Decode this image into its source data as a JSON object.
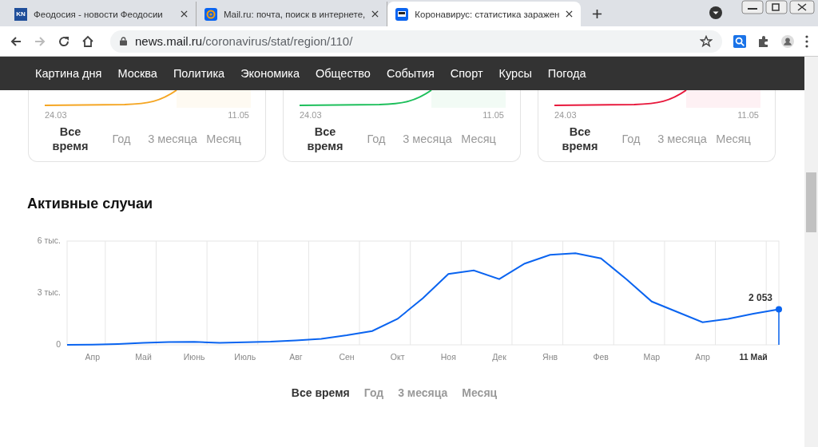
{
  "browser": {
    "tabs": [
      {
        "kind": "badge",
        "icon_text": "KN",
        "title": "Феодосия - новости Феодосии",
        "selected": false
      },
      {
        "kind": "at",
        "title": "Mail.ru: почта, поиск в интернете,",
        "selected": false
      },
      {
        "kind": "screen",
        "title": "Коронавирус: статистика заражен",
        "selected": true
      }
    ],
    "address": {
      "host": "news.mail.ru",
      "path": "/coronavirus/stat/region/110/"
    }
  },
  "nav": [
    "Картина дня",
    "Москва",
    "Политика",
    "Экономика",
    "Общество",
    "События",
    "Спорт",
    "Курсы",
    "Погода"
  ],
  "cards": [
    {
      "color": "#f5a623",
      "start": "24.03",
      "end": "11.05",
      "periods": [
        {
          "label": "Все время",
          "selected": true
        },
        {
          "label": "Год",
          "selected": false
        },
        {
          "label": "3 месяца",
          "selected": false
        },
        {
          "label": "Месяц",
          "selected": false
        }
      ]
    },
    {
      "color": "#1dbf5b",
      "start": "24.03",
      "end": "11.05",
      "periods": [
        {
          "label": "Все время",
          "selected": true
        },
        {
          "label": "Год",
          "selected": false
        },
        {
          "label": "3 месяца",
          "selected": false
        },
        {
          "label": "Месяц",
          "selected": false
        }
      ]
    },
    {
      "color": "#e8183c",
      "start": "24.03",
      "end": "11.05",
      "periods": [
        {
          "label": "Все время",
          "selected": true
        },
        {
          "label": "Год",
          "selected": false
        },
        {
          "label": "3 месяца",
          "selected": false
        },
        {
          "label": "Месяц",
          "selected": false
        }
      ]
    }
  ],
  "active": {
    "title": "Активные случаи",
    "chart_data": {
      "type": "line",
      "categories": [
        null,
        "Апр",
        null,
        "Май",
        null,
        "Июнь",
        null,
        "Июль",
        null,
        "Авг",
        null,
        "Сен",
        null,
        "Окт",
        null,
        "Ноя",
        null,
        "Дек",
        null,
        "Янв",
        null,
        "Фев",
        null,
        "Мар",
        null,
        "Апр",
        null,
        "11 Май",
        null
      ],
      "series": [
        {
          "color": "#0a64f0",
          "values": [
            0,
            0.01,
            0.05,
            0.12,
            0.16,
            0.17,
            0.12,
            0.15,
            0.18,
            0.25,
            0.35,
            0.55,
            0.8,
            1.5,
            2.7,
            4.1,
            4.3,
            3.8,
            4.7,
            5.2,
            5.3,
            5.0,
            3.8,
            2.5,
            1.9,
            1.3,
            1.5,
            1.8,
            2.05
          ]
        }
      ],
      "ylim": [
        0,
        6
      ],
      "yticks": [
        {
          "value": 0,
          "label": "0"
        },
        {
          "value": 3,
          "label": "3 тыс."
        },
        {
          "value": 6,
          "label": "6 тыс."
        }
      ],
      "annotations": [
        {
          "y": 2.05,
          "text": "2 053"
        }
      ]
    },
    "periods": [
      {
        "label": "Все время",
        "selected": true
      },
      {
        "label": "Год",
        "selected": false
      },
      {
        "label": "3 месяца",
        "selected": false
      },
      {
        "label": "Месяц",
        "selected": false
      }
    ]
  }
}
